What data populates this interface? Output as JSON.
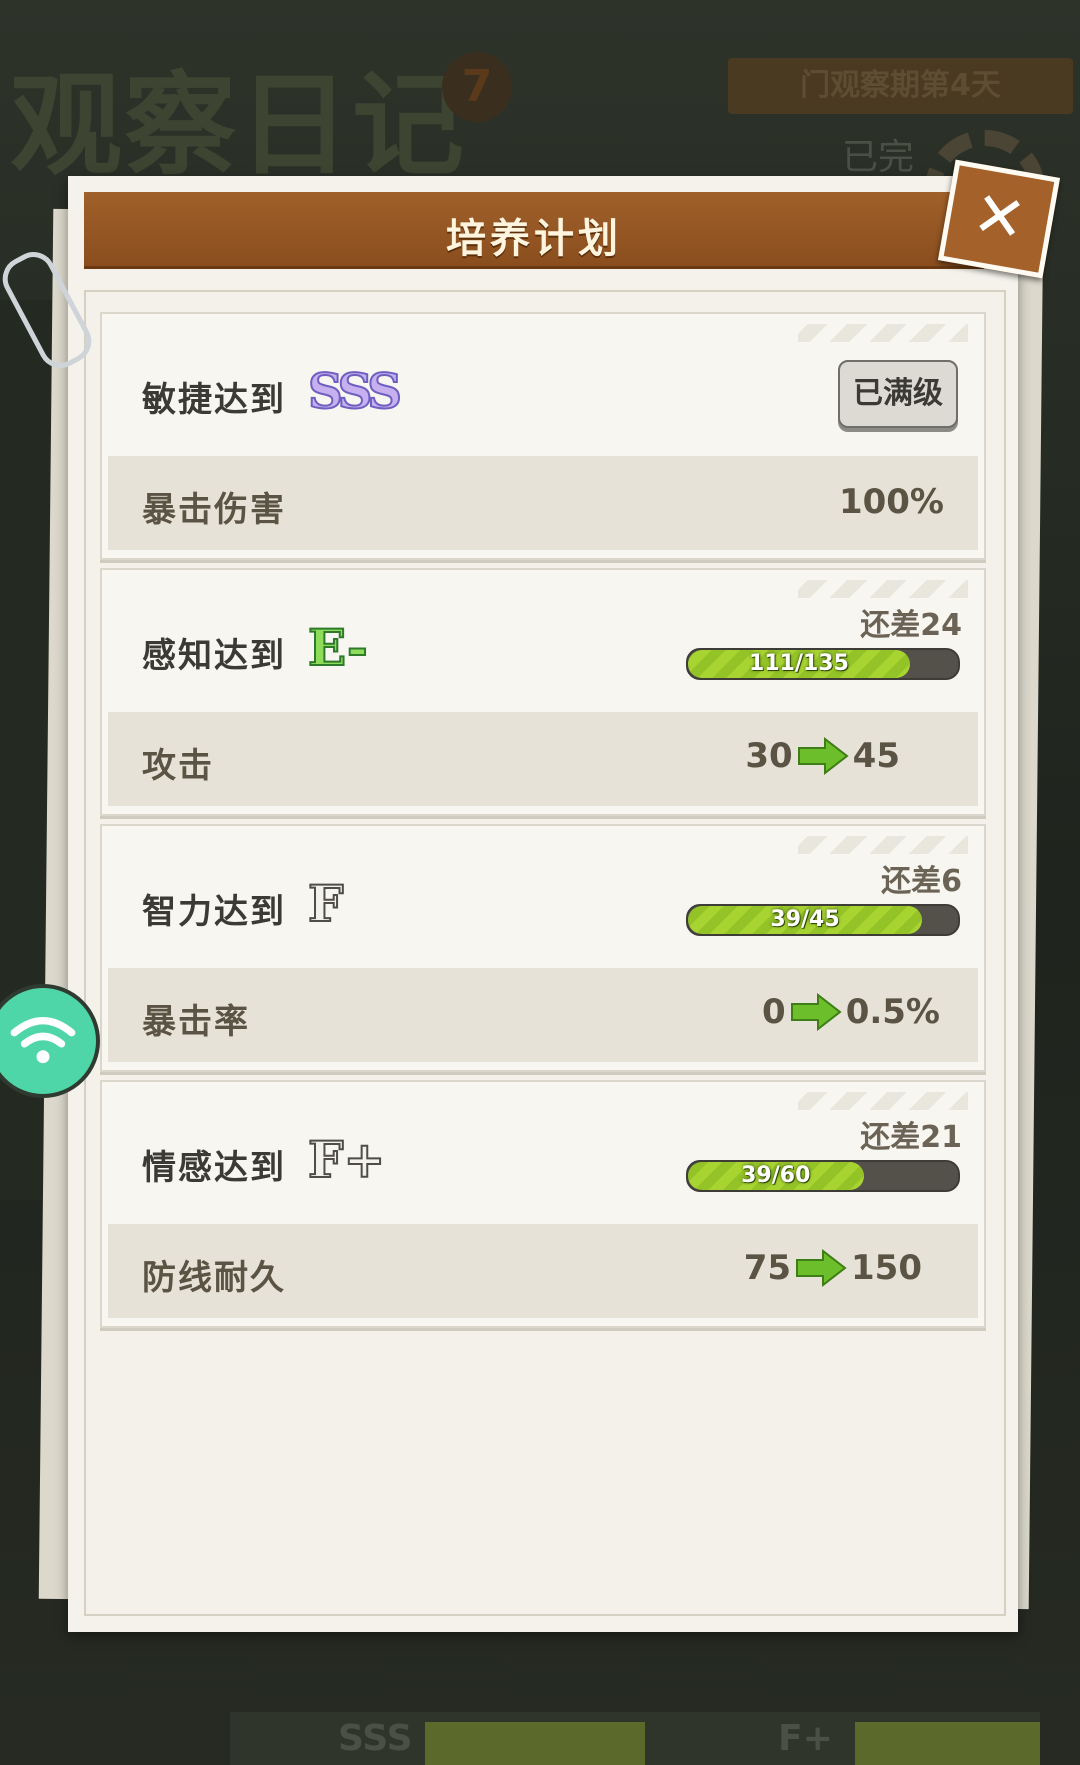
{
  "background": {
    "title": "观察日记",
    "badge": "7",
    "day_label": "门观察期第4天",
    "sub_label": "已完",
    "bottom_labels": [
      "SSS",
      "F+"
    ]
  },
  "dialog": {
    "title": "培养计划",
    "close_label": "✕"
  },
  "plans": [
    {
      "requirement": "敏捷达到",
      "grade": "SSS",
      "status_button": "已满级",
      "stat_name": "暴击伤害",
      "stat_value": "100%"
    },
    {
      "requirement": "感知达到",
      "grade": "E-",
      "remaining": "还差24",
      "progress_text": "111/135",
      "progress_fraction": 0.822,
      "stat_name": "攻击",
      "stat_from": "30",
      "stat_to": "45"
    },
    {
      "requirement": "智力达到",
      "grade": "F",
      "remaining": "还差6",
      "progress_text": "39/45",
      "progress_fraction": 0.867,
      "stat_name": "暴击率",
      "stat_from": "0",
      "stat_to": "0.5%"
    },
    {
      "requirement": "情感达到",
      "grade": "F+",
      "remaining": "还差21",
      "progress_text": "39/60",
      "progress_fraction": 0.65,
      "stat_name": "防线耐久",
      "stat_from": "75",
      "stat_to": "150"
    }
  ],
  "icons": {
    "close": "close-icon",
    "arrow": "arrow-right-icon",
    "wifi": "wifi-icon",
    "clip": "paperclip-icon"
  },
  "colors": {
    "header": "#9a5a26",
    "progress_fill": "#a8d432",
    "arrow": "#6cbf2a",
    "wifi_bubble": "#4fd6a8"
  }
}
